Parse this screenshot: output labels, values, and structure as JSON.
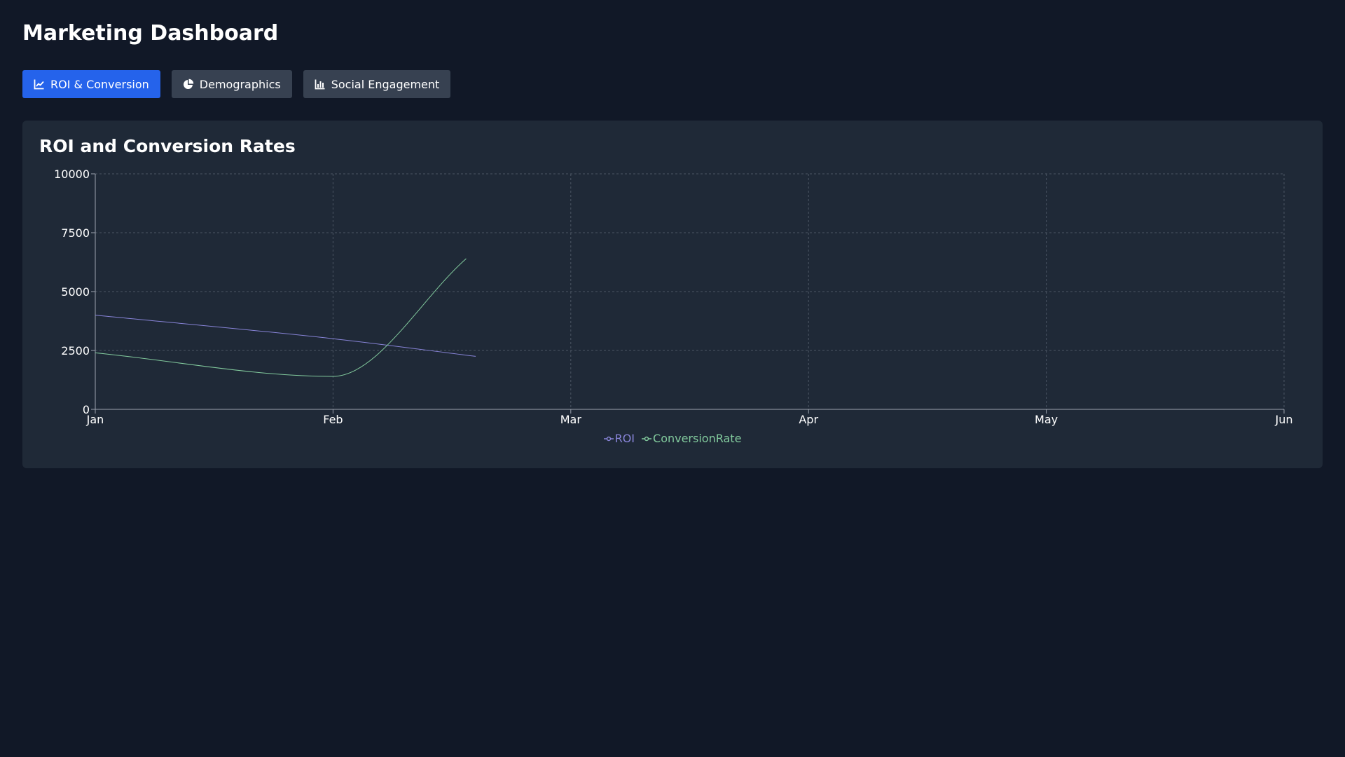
{
  "header": {
    "title": "Marketing Dashboard"
  },
  "tabs": [
    {
      "label": "ROI & Conversion",
      "icon": "line-chart-icon",
      "active": true
    },
    {
      "label": "Demographics",
      "icon": "pie-chart-icon",
      "active": false
    },
    {
      "label": "Social Engagement",
      "icon": "bar-chart-icon",
      "active": false
    }
  ],
  "card": {
    "title": "ROI and Conversion Rates"
  },
  "colors": {
    "accent": "#2563eb",
    "background": "#111827",
    "card": "#1f2937",
    "tab": "#374151",
    "roi": "#8884d8",
    "conversion": "#82ca9d"
  },
  "chart_data": {
    "type": "line",
    "categories": [
      "Jan",
      "Feb",
      "Mar",
      "Apr",
      "May",
      "Jun"
    ],
    "ylim": [
      0,
      10000
    ],
    "yticks": [
      0,
      2500,
      5000,
      7500,
      10000
    ],
    "grid": true,
    "legend": "bottom-center",
    "series": [
      {
        "name": "ROI",
        "color": "#8884d8",
        "points": [
          [
            0,
            4000
          ],
          [
            1,
            3000
          ],
          [
            1.6,
            2250
          ]
        ]
      },
      {
        "name": "ConversionRate",
        "color": "#82ca9d",
        "points": [
          [
            0,
            2400
          ],
          [
            1,
            1400
          ],
          [
            1.56,
            6400
          ]
        ]
      }
    ]
  }
}
